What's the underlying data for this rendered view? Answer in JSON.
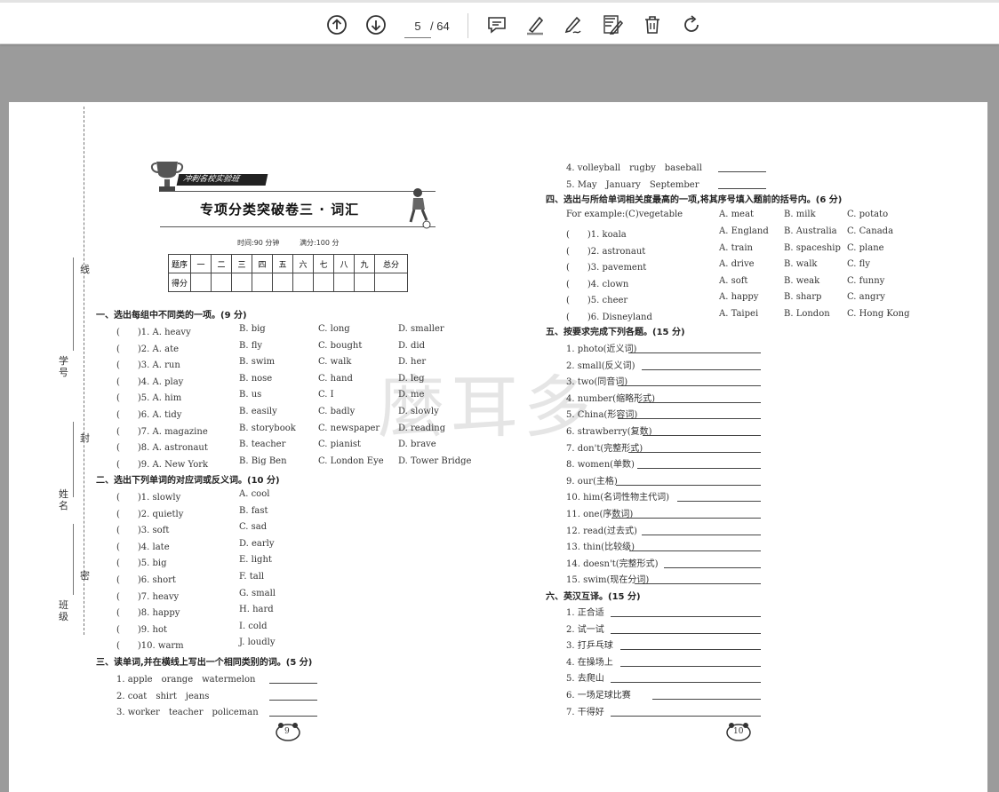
{
  "toolbar": {
    "current_page": "5",
    "total_pages": "/ 64",
    "icons": [
      "arrow-up-circle-icon",
      "arrow-down-circle-icon",
      "comment-icon",
      "highlighter-icon",
      "draw-icon",
      "edit-text-icon",
      "trash-icon",
      "rotate-icon"
    ]
  },
  "doc": {
    "banner": "冲刺名校实验班",
    "title": "专项分类突破卷三 · 词汇",
    "time": "时间:90 分钟",
    "full_score": "满分:100 分",
    "score_table": {
      "row1": [
        "题序",
        "一",
        "二",
        "三",
        "四",
        "五",
        "六",
        "七",
        "八",
        "九",
        "总分"
      ],
      "row2": [
        "得分",
        "",
        "",
        "",
        "",
        "",
        "",
        "",
        "",
        "",
        ""
      ]
    },
    "binding": {
      "name_student_id": "学号",
      "name": "姓名",
      "class": "班级",
      "xian": "线",
      "feng": "封",
      "mi": "密"
    },
    "watermark": "麼耳多",
    "section1": {
      "heading": "一、选出每组中不同类的一项。(9 分)",
      "items": [
        {
          "q": "(　　)1. A. heavy",
          "b": "B. big",
          "c": "C. long",
          "d": "D. smaller"
        },
        {
          "q": "(　　)2. A. ate",
          "b": "B. fly",
          "c": "C. bought",
          "d": "D. did"
        },
        {
          "q": "(　　)3. A. run",
          "b": "B. swim",
          "c": "C. walk",
          "d": "D. her"
        },
        {
          "q": "(　　)4. A. play",
          "b": "B. nose",
          "c": "C. hand",
          "d": "D. leg"
        },
        {
          "q": "(　　)5. A. him",
          "b": "B. us",
          "c": "C. I",
          "d": "D. me"
        },
        {
          "q": "(　　)6. A. tidy",
          "b": "B. easily",
          "c": "C. badly",
          "d": "D. slowly"
        },
        {
          "q": "(　　)7. A. magazine",
          "b": "B. storybook",
          "c": "C. newspaper",
          "d": "D. reading"
        },
        {
          "q": "(　　)8. A. astronaut",
          "b": "B. teacher",
          "c": "C. pianist",
          "d": "D. brave"
        },
        {
          "q": "(　　)9. A. New York",
          "b": "B. Big Ben",
          "c": "C. London Eye",
          "d": "D. Tower Bridge"
        }
      ]
    },
    "section2": {
      "heading": "二、选出下列单词的对应词或反义词。(10 分)",
      "items": [
        {
          "q": "(　　)1. slowly",
          "a": "A. cool"
        },
        {
          "q": "(　　)2. quietly",
          "a": "B. fast"
        },
        {
          "q": "(　　)3. soft",
          "a": "C. sad"
        },
        {
          "q": "(　　)4. late",
          "a": "D. early"
        },
        {
          "q": "(　　)5. big",
          "a": "E. light"
        },
        {
          "q": "(　　)6. short",
          "a": "F. tall"
        },
        {
          "q": "(　　)7. heavy",
          "a": "G. small"
        },
        {
          "q": "(　　)8. happy",
          "a": "H. hard"
        },
        {
          "q": "(　　)9. hot",
          "a": "I. cold"
        },
        {
          "q": "(　　)10. warm",
          "a": "J. loudly"
        }
      ]
    },
    "section3": {
      "heading": "三、读单词,并在横线上写出一个相同类别的词。(5 分)",
      "items": [
        "1. apple　orange　watermelon",
        "2. coat　shirt　jeans",
        "3. worker　teacher　policeman",
        "4. volleyball　rugby　baseball",
        "5. May　January　September"
      ]
    },
    "section4": {
      "heading": "四、选出与所给单词相关度最高的一项,将其序号填入题前的括号内。(6 分)",
      "example": {
        "q": "For example:(C)vegetable",
        "a": "A. meat",
        "b": "B. milk",
        "c": "C. potato"
      },
      "items": [
        {
          "q": "(　　)1. koala",
          "a": "A. England",
          "b": "B. Australia",
          "c": "C. Canada"
        },
        {
          "q": "(　　)2. astronaut",
          "a": "A. train",
          "b": "B. spaceship",
          "c": "C. plane"
        },
        {
          "q": "(　　)3. pavement",
          "a": "A. drive",
          "b": "B. walk",
          "c": "C. fly"
        },
        {
          "q": "(　　)4. clown",
          "a": "A. soft",
          "b": "B. weak",
          "c": "C. funny"
        },
        {
          "q": "(　　)5. cheer",
          "a": "A. happy",
          "b": "B. sharp",
          "c": "C. angry"
        },
        {
          "q": "(　　)6. Disneyland",
          "a": "A. Taipei",
          "b": "B. London",
          "c": "C. Hong Kong"
        }
      ]
    },
    "section5": {
      "heading": "五、按要求完成下列各题。(15 分)",
      "items": [
        "1. photo(近义词)",
        "2. small(反义词)",
        "3. two(同音词)",
        "4. number(缩略形式)",
        "5. China(形容词)",
        "6. strawberry(复数)",
        "7. don't(完整形式)",
        "8. women(单数)",
        "9. our(主格)",
        "10. him(名词性物主代词)",
        "11. one(序数词)",
        "12. read(过去式)",
        "13. thin(比较级)",
        "14. doesn't(完整形式)",
        "15. swim(现在分词)"
      ]
    },
    "section6": {
      "heading": "六、英汉互译。(15 分)",
      "items": [
        "1. 正合适",
        "2. 试一试",
        "3. 打乒乓球",
        "4. 在操场上",
        "5. 去爬山",
        "6. 一场足球比赛",
        "7. 干得好"
      ]
    },
    "page_left": "9",
    "page_right": "10"
  }
}
